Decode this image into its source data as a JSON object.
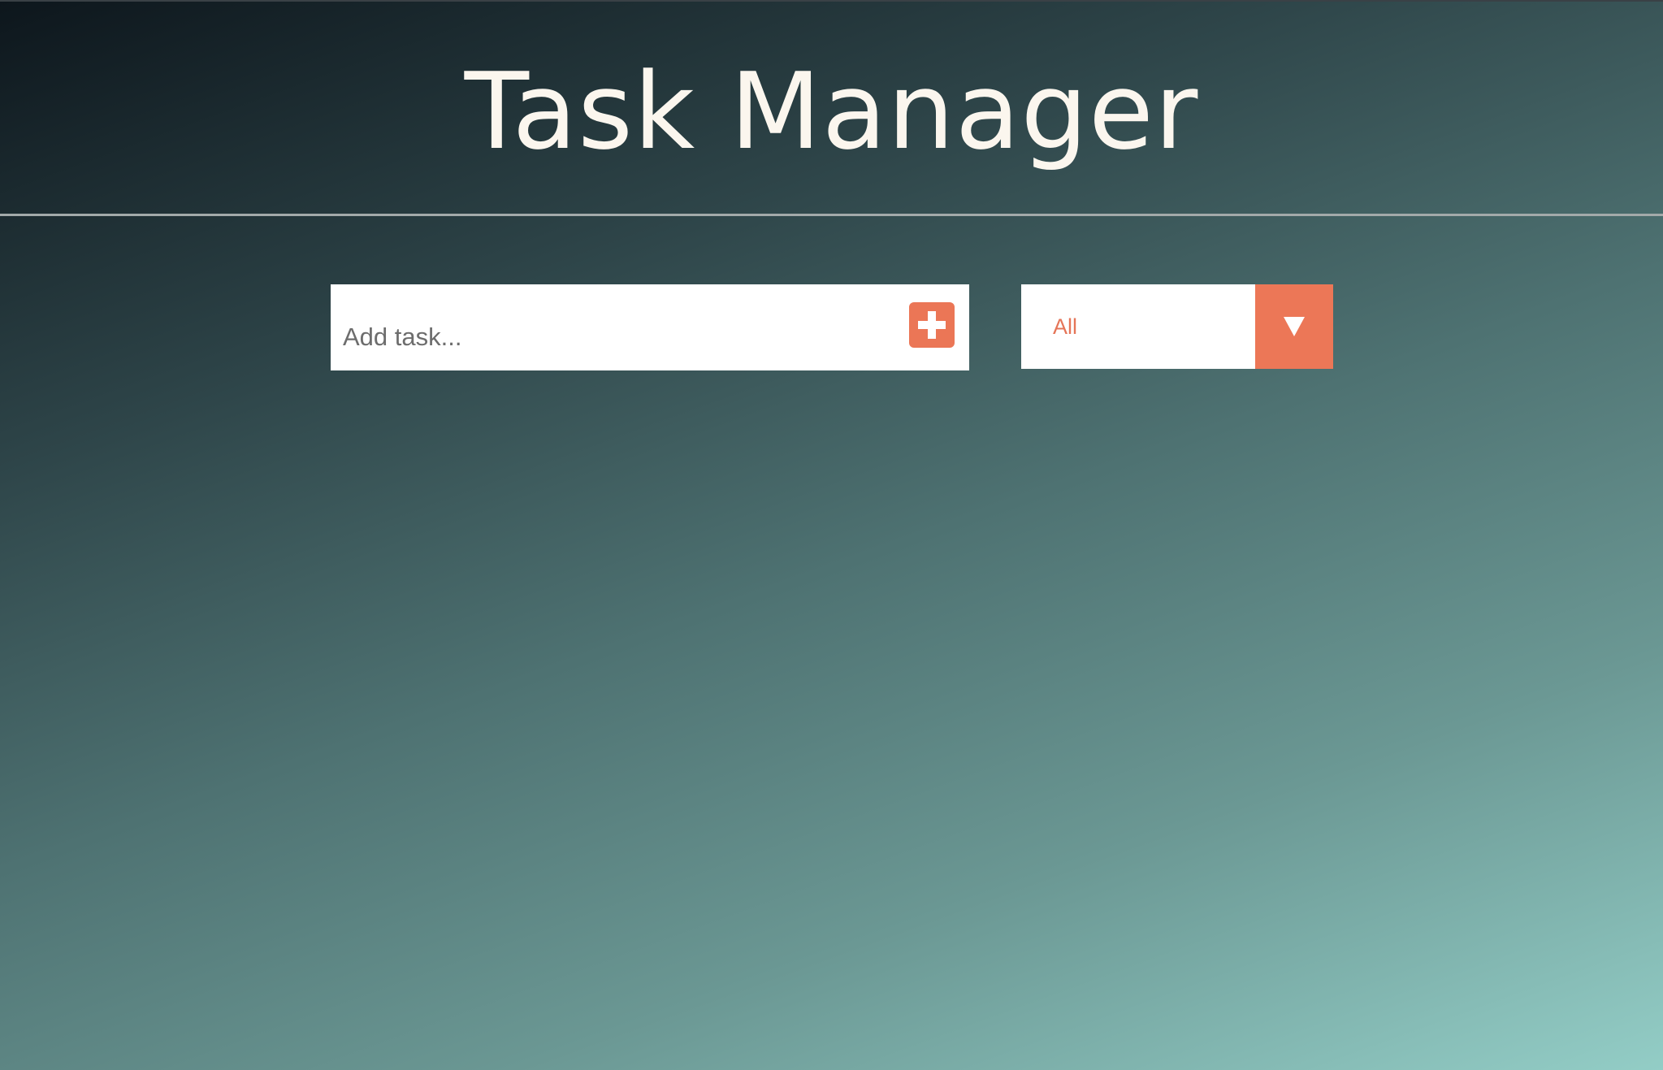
{
  "header": {
    "title": "Task Manager"
  },
  "add_task": {
    "placeholder": "Add task...",
    "value": "",
    "button_icon": "plus-square-icon"
  },
  "filter": {
    "selected": "All",
    "arrow_icon": "triangle-down-icon"
  },
  "colors": {
    "accent": "#eb7656",
    "title_text": "#fbf6ee",
    "gradient_start": "#0d161c",
    "gradient_end": "#93cdc6",
    "divider": "#a3aaaa"
  }
}
